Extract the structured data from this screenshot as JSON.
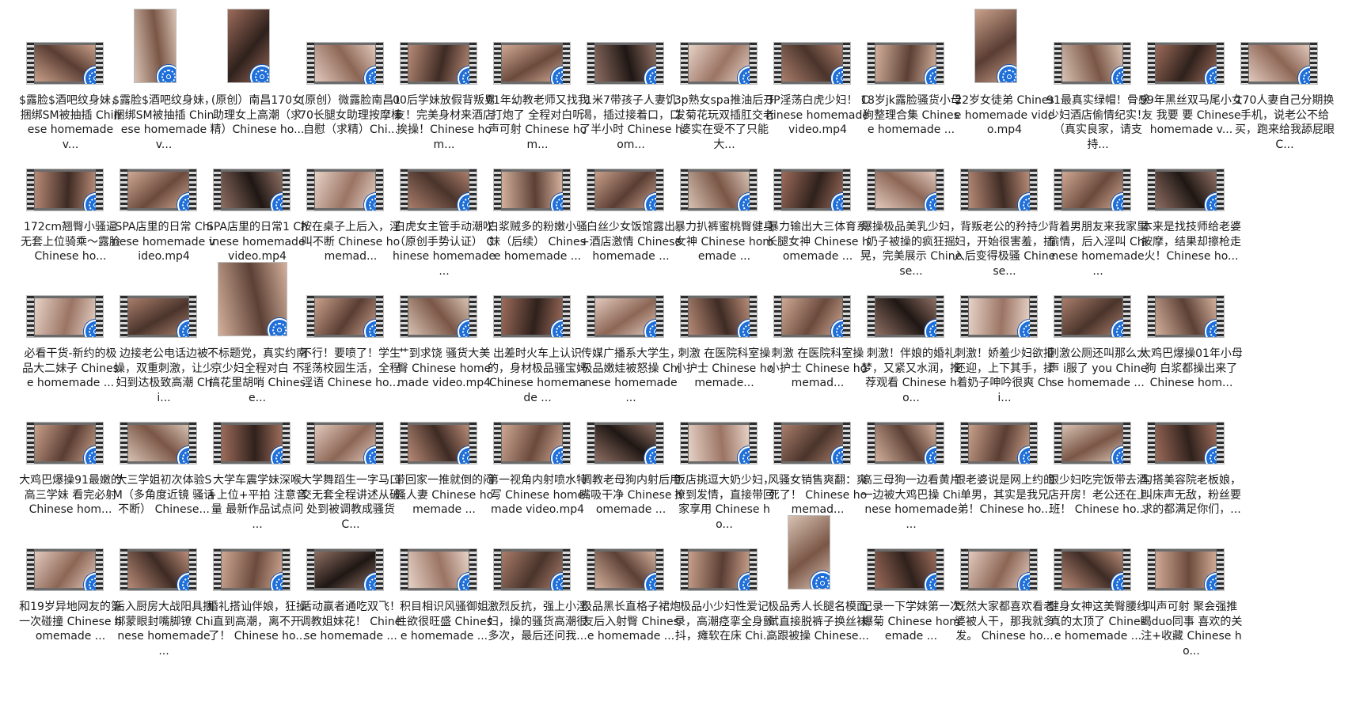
{
  "files": [
    [
      "$露脸$酒吧纹身妹，捆绑SM被抽插 Chinese homemade v...",
      "$露脸$酒吧纹身妹，捆绑SM被抽插 Chinese homemade v...",
      "(原创）南昌170女助理女上高潮（求精）Chinese ho...",
      "(原创）微露脸南昌170长腿女助理按摩棒自慰（求精）Chi...",
      "00后学妹放假背叛男友！完美身材来酒店挨操！Chinese hom...",
      "01年幼教老师又找我打炮了 全程对白听声可射 Chinese hom...",
      "1米7带孩子人妻饥渴，插过接着口，口了半小时 Chinese hom...",
      "3p熟女spa推油后开发菊花玩双插肛交老婆实在受不了只能大...",
      "3P淫荡白虎少妇！ Chinese homemade video.mp4",
      "18岁jk露脸骚货小母狗整理合集 Chinese homemade ...",
      "22岁女徒弟 Chinese homemade video.mp4",
      "91最真实绿帽！骨感少妇酒店偷情纪实！（真实良家，请支持...",
      "99年黑丝双马尾小女友 我要 要 Chinese homemade v...",
      "170人妻自己分期换手机，说老公不给买，跑来给我舔屁眼 C..."
    ],
    [
      "172cm翘臀小骚逼 无套上位骑乘～露脸 Chinese ho...",
      "SPA店里的日常 Chinese homemade video.mp4",
      "SPA店里的日常1 Chinese homemade video.mp4",
      "按在桌子上后入，淫叫不断 Chinese homemad...",
      "白虎女主管手动潮吹（原创手势认证） Chinese homemade ...",
      "白浆贼多的粉嫩小骚妹（后续） Chinese homemade ...",
      "白丝少女饭馆露出+酒店激情 Chinese homemade ...",
      "暴力扒裤蜜桃臀健身女神 Chinese homemade ...",
      "暴力输出大三体育系长腿女神 Chinese homemade ...",
      "爆操极品美乳少妇，奶子被操的疯狂摇晃，完美展示 Chinese...",
      "背叛老公的矜持少妇，开始很害羞，插入后变得极骚 Chinese...",
      "背着男朋友来我家里偷情，后入淫叫 Chinese homemade ...",
      "本来是找技师给老婆按摩，结果却擦枪走火！Chinese ho..."
    ],
    [
      "必看干货-新约的极品大二妹子 Chinese homemade ...",
      "边接老公电话边被操，双重刺激，让少妇到达极致高潮 Chi...",
      "不标题党，真实约南京少妇全程对白 不搞花里胡哨 Chinese...",
      "不行！要喷了！学生淫荡校园生活，全程淫语 Chinese ho...",
      "艹到求饶 骚货大美臀 Chinese homemade video.mp4",
      "出差时火车上认识的，身材极品骚宝妈 Chinese homemade ...",
      "传媒广播系大学生，极品嫩娃被怒操 Chinese homemade ...",
      "刺激 在医院科室操小护士 Chinese homemade...",
      "刺激 在医院科室操小护士 Chinese homemad...",
      "刺激！伴娘的婚礼梦，又紧又水润，推荐观看 Chinese ho...",
      "刺激！娇羞少妇欲拒还迎，上下其手，揉着奶子呻吟很爽 Chi...",
      "刺激公厕还叫那么大声 i服了 you Chinese homemade ...",
      "大鸡巴爆操01年小母狗 白浆都操出来了 Chinese hom..."
    ],
    [
      "大鸡巴爆操91最嫩的高三学妹 看完必射 Chinese hom...",
      "大三学姐初次体验SM（多角度近镜 骚话不断） Chinese...",
      "大学车震学妹深喉+上位+平拍 注意音量 最新作品试点问 ...",
      "大学舞蹈生一字马口交无套全程讲述从破处到被调教成骚货 C...",
      "带回家一推就倒的闷骚人妻 Chinese homemade ...",
      "第一视角内射喷水特写 Chinese homemade video.mp4",
      "调教老母狗内射后用嘴吸干净 Chinese homemade ...",
      "饭店挑逗大奶少妇，撩到发情，直接带回家享用 Chinese ho...",
      "风骚女销售爽翻：爽死了！ Chinese homemad...",
      "高三母狗一边看黄片一边被大鸡巴操 Chinese homemade ...",
      "跟老婆说是网上约的单男，其实是我兄弟！Chinese ho...",
      "跟少妇吃完饭带去酒店开房！老公还在上班！ Chinese ho...",
      "勾搭美容院老板娘，叫床声无敌，粉丝要求的都满足你们，..."
    ],
    [
      "和19岁异地网友的第一次碰撞 Chinese homemade ...",
      "后入厨房大战阳具捆绑蒙眼封嘴脚镣 Chinese homemade ...",
      "婚礼搭讪伴娘，狂操直到高潮，离不开了！ Chinese ho...",
      "活动赢者通吃双飞！调教姐妹花！ Chinese homemade ...",
      "积目相识风骚御姐 性欲很旺盛 Chinese homemade ...",
      "激烈反抗，强上小淫妇，操的骚货高潮很多次，最后还问我...",
      "极品黑长直格子裙炮友后入射臀 Chinese homemade ...",
      "极品小少妇性爱记录，高潮痉挛全身颤抖，瘫软在床 Chi...",
      "极品秀人长腿名模面试直接脱裤子换丝袜高跟被操 Chinese...",
      "记录一下学妹第一次爆菊 Chinese homemade ...",
      "既然大家都喜欢看老婆被人干，那我就多发。 Chinese ho...",
      "健身女神这美臀腰线真的太顶了 Chinese homemade ...",
      "叫声可射 聚会强推喝duo同事 喜欢的关注+收藏 Chinese ho..."
    ]
  ],
  "icons": {
    "video_badge": "video-player-icon"
  }
}
